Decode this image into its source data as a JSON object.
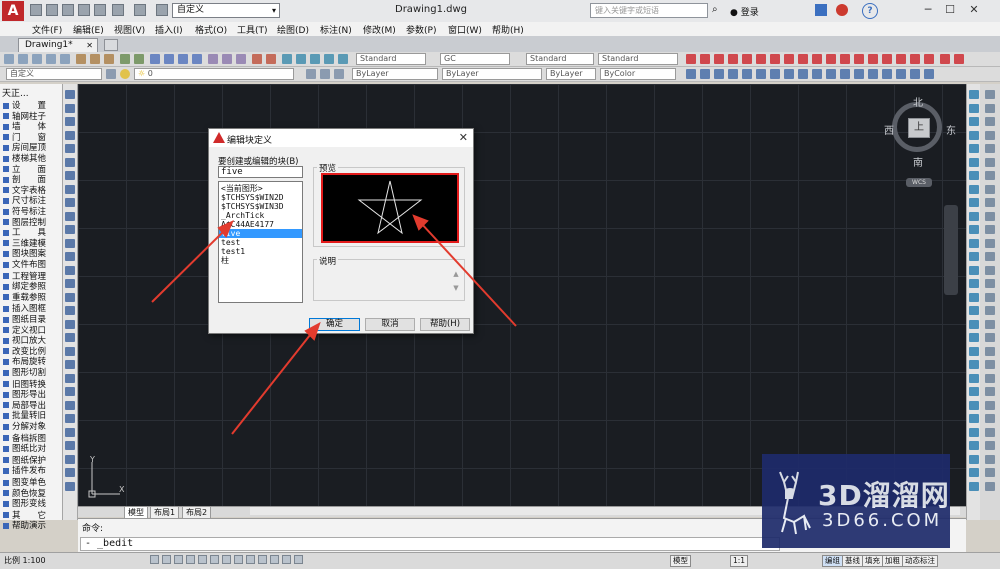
{
  "titlebar": {
    "workspace": "自定义",
    "document_title": "Drawing1.dwg",
    "search_placeholder": "键入关键字或短语",
    "login": "登录",
    "help": "?"
  },
  "menubar": [
    "文件(F)",
    "编辑(E)",
    "视图(V)",
    "插入(I)",
    "格式(O)",
    "工具(T)",
    "绘图(D)",
    "标注(N)",
    "修改(M)",
    "参数(P)",
    "窗口(W)",
    "帮助(H)"
  ],
  "tabs": {
    "active": "Drawing1*"
  },
  "toolbar": {
    "layer_combo": "自定义",
    "layer_num": "0",
    "text_style": "Standard",
    "dim_style": "GC",
    "table_style": "Standard",
    "mleader_style": "Standard",
    "color": "ByLayer",
    "linetype": "ByLayer",
    "lineweight": "ByLayer",
    "plotstyle": "ByColor"
  },
  "left_palette": {
    "header": "天正...",
    "items": [
      "设　　置",
      "轴网柱子",
      "墙　　体",
      "门　　窗",
      "房间屋顶",
      "楼梯其他",
      "立　　面",
      "剖　　面",
      "文字表格",
      "尺寸标注",
      "符号标注",
      "图层控制",
      "工　　具",
      "三维建模",
      "图块图案",
      "文件布图",
      "工程管理",
      "绑定参照",
      "重载参照",
      "插入图框",
      "图纸目录",
      "定义视口",
      "视口放大",
      "改变比例",
      "布局旋转",
      "图形切割",
      "旧图转换",
      "图形导出",
      "局部导出",
      "批量转旧",
      "分解对象",
      "备档拆图",
      "图纸比对",
      "图纸保护",
      "插件发布",
      "图变单色",
      "颜色恢复",
      "图形变线",
      "其　　它",
      "帮助演示"
    ]
  },
  "viewcube": {
    "north": "北",
    "south": "南",
    "east": "东",
    "west": "西",
    "top": "上",
    "wcs": "WCS"
  },
  "ucs": {
    "x": "X",
    "y": "Y"
  },
  "layout_tabs": [
    "模型",
    "布局1",
    "布局2"
  ],
  "command": {
    "label": "命令:",
    "line": "- _bedit"
  },
  "status": {
    "scale": "比例 1:100",
    "buttons": [
      "模型",
      "1:1",
      "编组",
      "基线",
      "填充",
      "加粗",
      "动态标注"
    ]
  },
  "dialog": {
    "title": "编辑块定义",
    "block_label": "要创建或编辑的块(B)",
    "block_name": "five",
    "block_list": [
      "<当前图形>",
      "$TCHSYS$WIN2D",
      "$TCHSYS$WIN3D",
      "_ArchTick",
      "A$C44AE4177",
      "five",
      "test",
      "test1",
      "柱"
    ],
    "selected": "five",
    "preview_label": "预览",
    "description_label": "说明",
    "ok": "确定",
    "cancel": "取消",
    "help": "帮助(H)"
  },
  "watermark": {
    "line1": "3D溜溜网",
    "line2": "3D66.COM"
  },
  "colors": {
    "accent_red": "#e31b1b",
    "selection": "#3399ff",
    "canvas": "#1a1d22",
    "watermark_bg": "#1e2b6b"
  }
}
